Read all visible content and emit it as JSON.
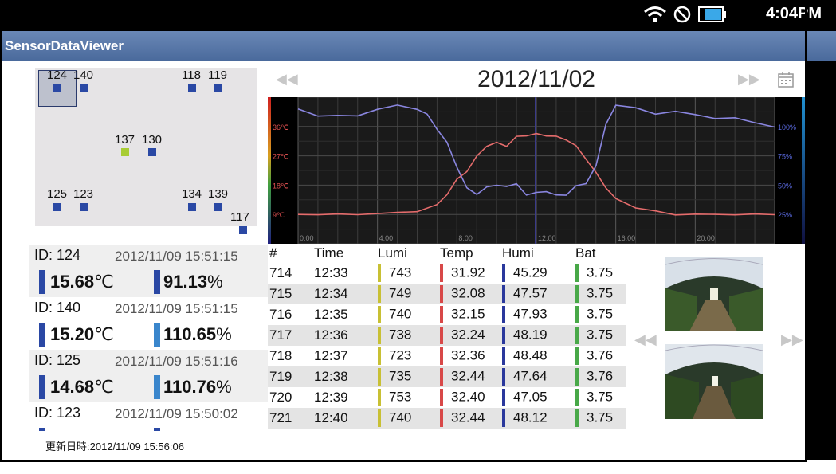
{
  "status_bar": {
    "time": "4:04PM",
    "icons": [
      "wifi-icon",
      "do-not-disturb-icon",
      "battery-icon"
    ]
  },
  "app": {
    "title": "SensorDataViewer"
  },
  "map": {
    "nodes": [
      {
        "id": "124",
        "label": "124"
      },
      {
        "id": "140",
        "label": "140"
      },
      {
        "id": "118",
        "label": "118"
      },
      {
        "id": "119",
        "label": "119"
      },
      {
        "id": "137",
        "label": "137"
      },
      {
        "id": "130",
        "label": "130"
      },
      {
        "id": "125",
        "label": "125"
      },
      {
        "id": "123",
        "label": "123"
      },
      {
        "id": "134",
        "label": "134"
      },
      {
        "id": "139",
        "label": "139"
      },
      {
        "id": "117",
        "label": "117"
      }
    ],
    "selected": "124"
  },
  "sensors": [
    {
      "id_label": "ID: 124",
      "time": "2012/11/09 15:51:15",
      "temp": "15.68",
      "temp_unit": "℃",
      "humi": "91.13",
      "humi_unit": "%"
    },
    {
      "id_label": "ID: 140",
      "time": "2012/11/09 15:51:15",
      "temp": "15.20",
      "temp_unit": "℃",
      "humi": "110.65",
      "humi_unit": "%"
    },
    {
      "id_label": "ID: 125",
      "time": "2012/11/09 15:51:16",
      "temp": "14.68",
      "temp_unit": "℃",
      "humi": "110.76",
      "humi_unit": "%"
    },
    {
      "id_label": "ID: 123",
      "time": "2012/11/09 15:50:02",
      "temp": "",
      "temp_unit": "",
      "humi": "",
      "humi_unit": ""
    }
  ],
  "updated": "更新日時:2012/11/09 15:56:06",
  "date_nav": {
    "date": "2012/11/02",
    "prev_icon": "rewind-icon",
    "next_icon": "fast-forward-icon",
    "calendar_icon": "calendar-icon"
  },
  "chart_data": {
    "type": "line",
    "y_left_ticks": [
      "36℃",
      "27℃",
      "18℃",
      "9℃"
    ],
    "y_right_ticks": [
      "100%",
      "75%",
      "50%",
      "25%"
    ],
    "x_ticks": [
      "0:00",
      "4:00",
      "8:00",
      "12:00",
      "16:00",
      "20:00"
    ],
    "x_range": [
      0,
      24
    ],
    "temp_range_c": [
      0,
      45
    ],
    "humi_range_pct": [
      0,
      125
    ],
    "grid": true,
    "series": [
      {
        "color": "#e56c6c",
        "x": [
          0,
          1,
          2,
          3,
          4,
          5,
          6,
          7,
          7.5,
          8,
          8.5,
          9,
          9.5,
          10,
          10.5,
          11,
          11.5,
          12,
          12.5,
          13,
          13.5,
          14,
          14.5,
          15,
          15.5,
          16,
          17,
          18,
          19,
          20,
          21,
          22,
          23,
          24
        ],
        "y": [
          9,
          9,
          9,
          9,
          9.3,
          9.5,
          10,
          12,
          15,
          20,
          22,
          27,
          30,
          31,
          30,
          33,
          33,
          34,
          33,
          33,
          32,
          30,
          26,
          22,
          17,
          14,
          11,
          10,
          9,
          9,
          9,
          9,
          9,
          9
        ]
      },
      {
        "color": "#8a86e0",
        "x": [
          0,
          1,
          2,
          3,
          4,
          5,
          6,
          6.5,
          7,
          7.5,
          8,
          8.5,
          9,
          9.5,
          10,
          10.5,
          11,
          11.5,
          12,
          12.5,
          13,
          13.5,
          14,
          14.5,
          15,
          15.5,
          16,
          17,
          18,
          19,
          20,
          21,
          22,
          23,
          24
        ],
        "y": [
          115,
          110,
          108,
          110,
          115,
          117,
          116,
          110,
          97,
          88,
          64,
          48,
          43,
          47,
          51,
          49,
          50,
          43,
          43,
          44,
          43,
          40,
          50,
          52,
          65,
          103,
          118,
          115,
          112,
          112,
          110,
          108,
          106,
          104,
          100
        ]
      }
    ]
  },
  "table": {
    "headers": [
      "#",
      "Time",
      "Lumi",
      "Temp",
      "Humi",
      "Bat"
    ],
    "rows": [
      [
        "714",
        "12:33",
        "743",
        "31.92",
        "45.29",
        "3.75"
      ],
      [
        "715",
        "12:34",
        "749",
        "32.08",
        "47.57",
        "3.75"
      ],
      [
        "716",
        "12:35",
        "740",
        "32.15",
        "47.93",
        "3.75"
      ],
      [
        "717",
        "12:36",
        "738",
        "32.24",
        "48.19",
        "3.75"
      ],
      [
        "718",
        "12:37",
        "723",
        "32.36",
        "48.48",
        "3.76"
      ],
      [
        "719",
        "12:38",
        "735",
        "32.44",
        "47.64",
        "3.76"
      ],
      [
        "720",
        "12:39",
        "753",
        "32.40",
        "47.05",
        "3.75"
      ],
      [
        "721",
        "12:40",
        "740",
        "32.44",
        "48.12",
        "3.75"
      ]
    ],
    "column_colors": {
      "Lumi": "#c8c034",
      "Temp": "#d84848",
      "Humi": "#2a389c",
      "Bat": "#48a848"
    }
  },
  "photos": {
    "count": 2,
    "prev_icon": "rewind-icon",
    "next_icon": "fast-forward-icon"
  }
}
